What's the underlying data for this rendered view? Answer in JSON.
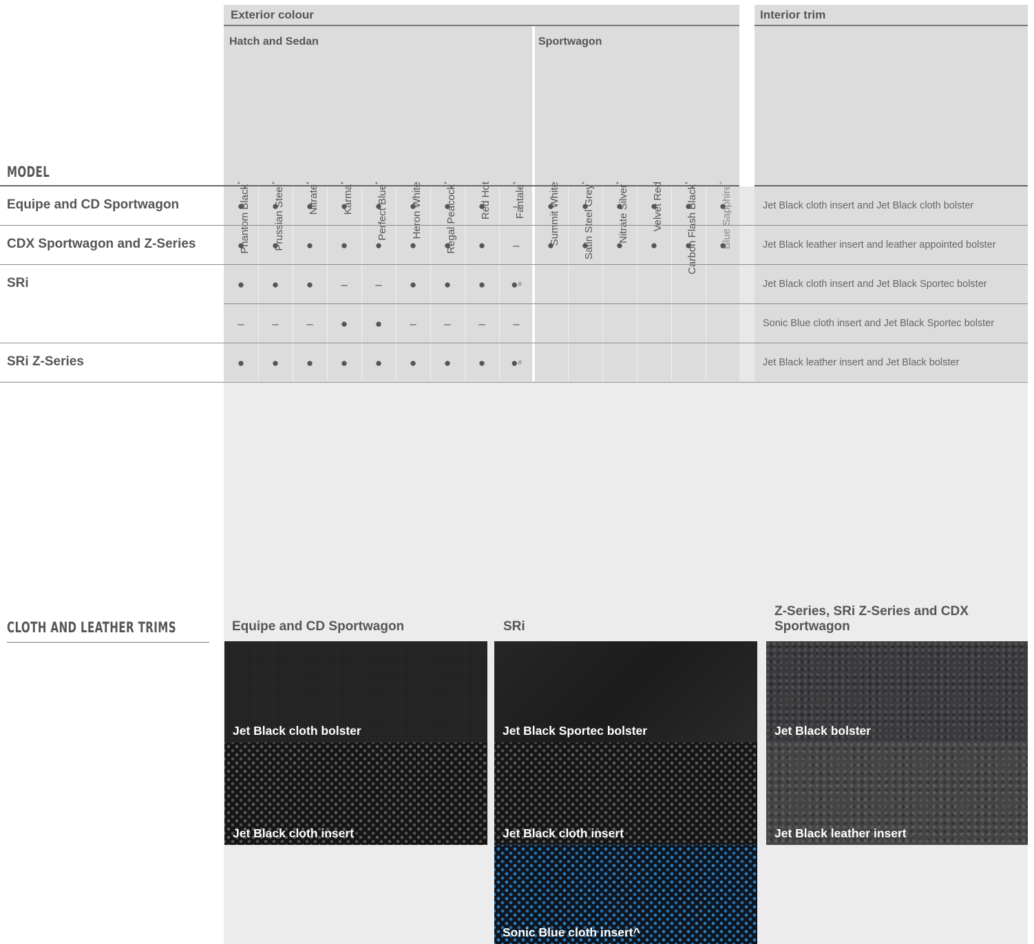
{
  "table": {
    "model_title": "MODEL",
    "exterior_header": "Exterior colour",
    "interior_header": "Interior trim",
    "group_hatch": "Hatch and Sedan",
    "group_sportwagon": "Sportwagon",
    "columns": [
      {
        "name": "Phantom Black",
        "asterisk": "*"
      },
      {
        "name": "Prussian Steel",
        "asterisk": "*"
      },
      {
        "name": "Nitrate",
        "asterisk": "*"
      },
      {
        "name": "Karma",
        "asterisk": "*"
      },
      {
        "name": "Perfect Blue",
        "asterisk": "*"
      },
      {
        "name": "Heron White",
        "asterisk": ""
      },
      {
        "name": "Regal Peacock",
        "asterisk": "*"
      },
      {
        "name": "Red Hot",
        "asterisk": ""
      },
      {
        "name": "Fantale",
        "asterisk": "*"
      },
      {
        "name": "Summit White",
        "asterisk": ""
      },
      {
        "name": "Satin Steel Grey",
        "asterisk": "*"
      },
      {
        "name": "Nitrate Silver",
        "asterisk": "*"
      },
      {
        "name": "Velvet Red",
        "asterisk": ""
      },
      {
        "name": "Carbon Flash Black",
        "asterisk": "*"
      },
      {
        "name": "Blue Sapphire",
        "asterisk": "*"
      }
    ],
    "rows": [
      {
        "model": "Equipe and CD Sportwagon",
        "cells": [
          "●",
          "●",
          "●",
          "●",
          "●",
          "●",
          "●",
          "●",
          "–",
          "●",
          "●",
          "●",
          "●",
          "●",
          "●"
        ],
        "trim": "Jet Black cloth insert and Jet Black cloth bolster"
      },
      {
        "model": "CDX Sportwagon and Z-Series",
        "cells": [
          "●",
          "●",
          "●",
          "●",
          "●",
          "●",
          "●",
          "●",
          "–",
          "●",
          "●",
          "●",
          "●",
          "●",
          "●"
        ],
        "trim": "Jet Black leather insert and leather appointed bolster"
      },
      {
        "model": "SRi",
        "cells": [
          "●",
          "●",
          "●",
          "–",
          "–",
          "●",
          "●",
          "●",
          "●",
          "",
          "",
          "",
          "",
          "",
          ""
        ],
        "trim": "Jet Black cloth insert and Jet Black Sportec bolster"
      },
      {
        "model": "",
        "cells": [
          "–",
          "–",
          "–",
          "●",
          "●",
          "–",
          "–",
          "–",
          "–",
          "",
          "",
          "",
          "",
          "",
          ""
        ],
        "trim": "Sonic Blue cloth insert and Jet Black Sportec bolster"
      },
      {
        "model": "SRi Z-Series",
        "cells": [
          "●",
          "●",
          "●",
          "●",
          "●",
          "●",
          "●",
          "●",
          "●",
          "",
          "",
          "",
          "",
          "",
          ""
        ],
        "trim": "Jet Black leather insert and Jet Black bolster"
      }
    ],
    "hash_mark": "#"
  },
  "trims": {
    "title": "CLOTH AND LEATHER TRIMS",
    "groups": [
      {
        "title": "Equipe and CD Sportwagon",
        "swatches": [
          "Jet Black cloth bolster",
          "Jet Black cloth insert"
        ]
      },
      {
        "title": "SRi",
        "swatches": [
          "Jet Black Sportec bolster",
          "Jet Black cloth insert",
          "Sonic Blue cloth insert^"
        ]
      },
      {
        "title": "Z-Series, SRi Z-Series and CDX Sportwagon",
        "swatches": [
          "Jet Black bolster",
          "Jet Black leather insert"
        ]
      }
    ]
  }
}
